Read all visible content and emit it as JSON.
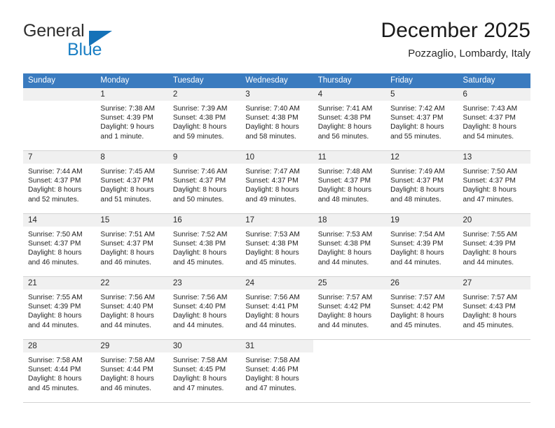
{
  "brand": {
    "name_part1": "General",
    "name_part2": "Blue",
    "triangle_color": "#1572b8",
    "blue_color": "#1b7fc4"
  },
  "header": {
    "title": "December 2025",
    "subtitle": "Pozzaglio, Lombardy, Italy"
  },
  "theme": {
    "header_row_bg": "#3a7bbf",
    "day_number_bg": "#f0f0f0",
    "grid_line": "#d3d3d3"
  },
  "weekdays": [
    "Sunday",
    "Monday",
    "Tuesday",
    "Wednesday",
    "Thursday",
    "Friday",
    "Saturday"
  ],
  "weeks": [
    [
      {
        "day": "",
        "empty": true
      },
      {
        "day": "1",
        "sunrise": "Sunrise: 7:38 AM",
        "sunset": "Sunset: 4:39 PM",
        "daylight_line1": "Daylight: 9 hours",
        "daylight_line2": "and 1 minute."
      },
      {
        "day": "2",
        "sunrise": "Sunrise: 7:39 AM",
        "sunset": "Sunset: 4:38 PM",
        "daylight_line1": "Daylight: 8 hours",
        "daylight_line2": "and 59 minutes."
      },
      {
        "day": "3",
        "sunrise": "Sunrise: 7:40 AM",
        "sunset": "Sunset: 4:38 PM",
        "daylight_line1": "Daylight: 8 hours",
        "daylight_line2": "and 58 minutes."
      },
      {
        "day": "4",
        "sunrise": "Sunrise: 7:41 AM",
        "sunset": "Sunset: 4:38 PM",
        "daylight_line1": "Daylight: 8 hours",
        "daylight_line2": "and 56 minutes."
      },
      {
        "day": "5",
        "sunrise": "Sunrise: 7:42 AM",
        "sunset": "Sunset: 4:37 PM",
        "daylight_line1": "Daylight: 8 hours",
        "daylight_line2": "and 55 minutes."
      },
      {
        "day": "6",
        "sunrise": "Sunrise: 7:43 AM",
        "sunset": "Sunset: 4:37 PM",
        "daylight_line1": "Daylight: 8 hours",
        "daylight_line2": "and 54 minutes."
      }
    ],
    [
      {
        "day": "7",
        "sunrise": "Sunrise: 7:44 AM",
        "sunset": "Sunset: 4:37 PM",
        "daylight_line1": "Daylight: 8 hours",
        "daylight_line2": "and 52 minutes."
      },
      {
        "day": "8",
        "sunrise": "Sunrise: 7:45 AM",
        "sunset": "Sunset: 4:37 PM",
        "daylight_line1": "Daylight: 8 hours",
        "daylight_line2": "and 51 minutes."
      },
      {
        "day": "9",
        "sunrise": "Sunrise: 7:46 AM",
        "sunset": "Sunset: 4:37 PM",
        "daylight_line1": "Daylight: 8 hours",
        "daylight_line2": "and 50 minutes."
      },
      {
        "day": "10",
        "sunrise": "Sunrise: 7:47 AM",
        "sunset": "Sunset: 4:37 PM",
        "daylight_line1": "Daylight: 8 hours",
        "daylight_line2": "and 49 minutes."
      },
      {
        "day": "11",
        "sunrise": "Sunrise: 7:48 AM",
        "sunset": "Sunset: 4:37 PM",
        "daylight_line1": "Daylight: 8 hours",
        "daylight_line2": "and 48 minutes."
      },
      {
        "day": "12",
        "sunrise": "Sunrise: 7:49 AM",
        "sunset": "Sunset: 4:37 PM",
        "daylight_line1": "Daylight: 8 hours",
        "daylight_line2": "and 48 minutes."
      },
      {
        "day": "13",
        "sunrise": "Sunrise: 7:50 AM",
        "sunset": "Sunset: 4:37 PM",
        "daylight_line1": "Daylight: 8 hours",
        "daylight_line2": "and 47 minutes."
      }
    ],
    [
      {
        "day": "14",
        "sunrise": "Sunrise: 7:50 AM",
        "sunset": "Sunset: 4:37 PM",
        "daylight_line1": "Daylight: 8 hours",
        "daylight_line2": "and 46 minutes."
      },
      {
        "day": "15",
        "sunrise": "Sunrise: 7:51 AM",
        "sunset": "Sunset: 4:37 PM",
        "daylight_line1": "Daylight: 8 hours",
        "daylight_line2": "and 46 minutes."
      },
      {
        "day": "16",
        "sunrise": "Sunrise: 7:52 AM",
        "sunset": "Sunset: 4:38 PM",
        "daylight_line1": "Daylight: 8 hours",
        "daylight_line2": "and 45 minutes."
      },
      {
        "day": "17",
        "sunrise": "Sunrise: 7:53 AM",
        "sunset": "Sunset: 4:38 PM",
        "daylight_line1": "Daylight: 8 hours",
        "daylight_line2": "and 45 minutes."
      },
      {
        "day": "18",
        "sunrise": "Sunrise: 7:53 AM",
        "sunset": "Sunset: 4:38 PM",
        "daylight_line1": "Daylight: 8 hours",
        "daylight_line2": "and 44 minutes."
      },
      {
        "day": "19",
        "sunrise": "Sunrise: 7:54 AM",
        "sunset": "Sunset: 4:39 PM",
        "daylight_line1": "Daylight: 8 hours",
        "daylight_line2": "and 44 minutes."
      },
      {
        "day": "20",
        "sunrise": "Sunrise: 7:55 AM",
        "sunset": "Sunset: 4:39 PM",
        "daylight_line1": "Daylight: 8 hours",
        "daylight_line2": "and 44 minutes."
      }
    ],
    [
      {
        "day": "21",
        "sunrise": "Sunrise: 7:55 AM",
        "sunset": "Sunset: 4:39 PM",
        "daylight_line1": "Daylight: 8 hours",
        "daylight_line2": "and 44 minutes."
      },
      {
        "day": "22",
        "sunrise": "Sunrise: 7:56 AM",
        "sunset": "Sunset: 4:40 PM",
        "daylight_line1": "Daylight: 8 hours",
        "daylight_line2": "and 44 minutes."
      },
      {
        "day": "23",
        "sunrise": "Sunrise: 7:56 AM",
        "sunset": "Sunset: 4:40 PM",
        "daylight_line1": "Daylight: 8 hours",
        "daylight_line2": "and 44 minutes."
      },
      {
        "day": "24",
        "sunrise": "Sunrise: 7:56 AM",
        "sunset": "Sunset: 4:41 PM",
        "daylight_line1": "Daylight: 8 hours",
        "daylight_line2": "and 44 minutes."
      },
      {
        "day": "25",
        "sunrise": "Sunrise: 7:57 AM",
        "sunset": "Sunset: 4:42 PM",
        "daylight_line1": "Daylight: 8 hours",
        "daylight_line2": "and 44 minutes."
      },
      {
        "day": "26",
        "sunrise": "Sunrise: 7:57 AM",
        "sunset": "Sunset: 4:42 PM",
        "daylight_line1": "Daylight: 8 hours",
        "daylight_line2": "and 45 minutes."
      },
      {
        "day": "27",
        "sunrise": "Sunrise: 7:57 AM",
        "sunset": "Sunset: 4:43 PM",
        "daylight_line1": "Daylight: 8 hours",
        "daylight_line2": "and 45 minutes."
      }
    ],
    [
      {
        "day": "28",
        "sunrise": "Sunrise: 7:58 AM",
        "sunset": "Sunset: 4:44 PM",
        "daylight_line1": "Daylight: 8 hours",
        "daylight_line2": "and 45 minutes."
      },
      {
        "day": "29",
        "sunrise": "Sunrise: 7:58 AM",
        "sunset": "Sunset: 4:44 PM",
        "daylight_line1": "Daylight: 8 hours",
        "daylight_line2": "and 46 minutes."
      },
      {
        "day": "30",
        "sunrise": "Sunrise: 7:58 AM",
        "sunset": "Sunset: 4:45 PM",
        "daylight_line1": "Daylight: 8 hours",
        "daylight_line2": "and 47 minutes."
      },
      {
        "day": "31",
        "sunrise": "Sunrise: 7:58 AM",
        "sunset": "Sunset: 4:46 PM",
        "daylight_line1": "Daylight: 8 hours",
        "daylight_line2": "and 47 minutes."
      },
      {
        "day": "",
        "empty": true,
        "blank": true
      },
      {
        "day": "",
        "empty": true,
        "blank": true
      },
      {
        "day": "",
        "empty": true,
        "blank": true
      }
    ]
  ]
}
